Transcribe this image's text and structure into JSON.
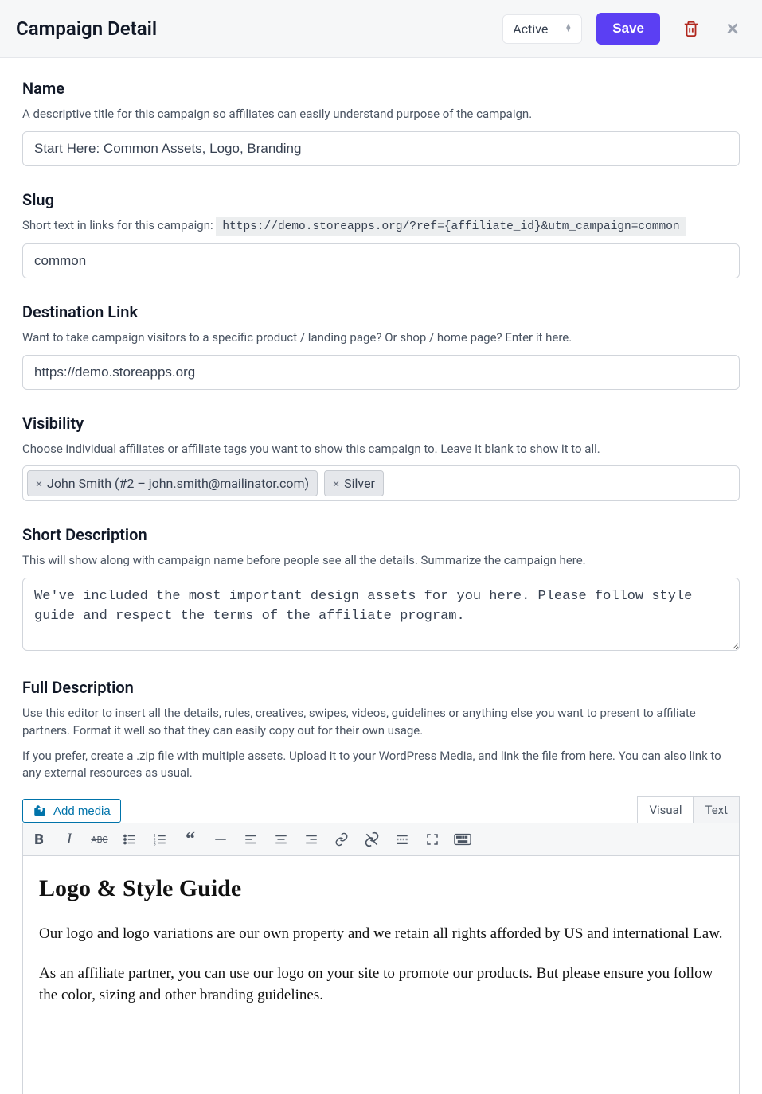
{
  "header": {
    "title": "Campaign Detail",
    "status_value": "Active",
    "save_label": "Save"
  },
  "name": {
    "label": "Name",
    "help": "A descriptive title for this campaign so affiliates can easily understand purpose of the campaign.",
    "value": "Start Here: Common Assets, Logo, Branding"
  },
  "slug": {
    "label": "Slug",
    "help_prefix": "Short text in links for this campaign: ",
    "example_url": "https://demo.storeapps.org/?ref={affiliate_id}&utm_campaign=common",
    "value": "common"
  },
  "destination": {
    "label": "Destination Link",
    "help": "Want to take campaign visitors to a specific product / landing page? Or shop / home page? Enter it here.",
    "value": "https://demo.storeapps.org"
  },
  "visibility": {
    "label": "Visibility",
    "help": "Choose individual affiliates or affiliate tags you want to show this campaign to. Leave it blank to show it to all.",
    "tags": [
      "John Smith (#2 – john.smith@mailinator.com)",
      "Silver"
    ]
  },
  "short_description": {
    "label": "Short Description",
    "help": "This will show along with campaign name before people see all the details. Summarize the campaign here.",
    "value": "We've included the most important design assets for you here. Please follow style guide and respect the terms of the affiliate program."
  },
  "full_description": {
    "label": "Full Description",
    "help1": "Use this editor to insert all the details, rules, creatives, swipes, videos, guidelines or anything else you want to present to affiliate partners. Format it well so that they can easily copy out for their own usage.",
    "help2": "If you prefer, create a .zip file with multiple assets. Upload it to your WordPress Media, and link the file from here. You can also link to any external resources as usual."
  },
  "editor": {
    "add_media_label": "Add media",
    "tabs": {
      "visual": "Visual",
      "text": "Text"
    },
    "content": {
      "heading": "Logo & Style Guide",
      "p1": "Our logo and logo variations are our own property and we retain all rights afforded by US and international Law.",
      "p2": "As an affiliate partner, you can use our logo on your site to promote our products. But please ensure you follow the color, sizing and other branding guidelines."
    }
  }
}
